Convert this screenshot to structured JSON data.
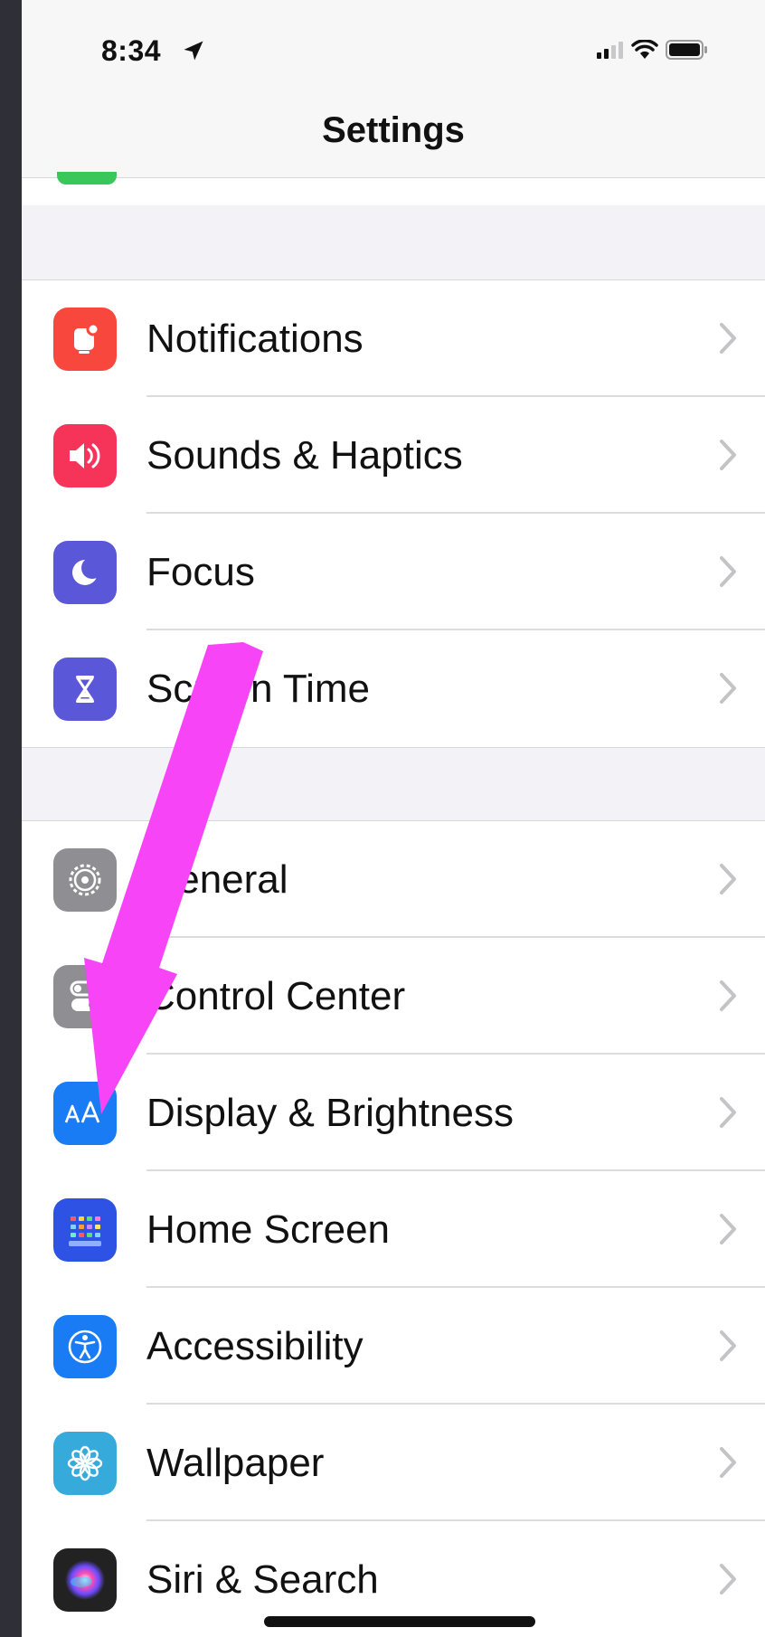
{
  "status_bar": {
    "time": "8:34",
    "icons": [
      "location-arrow-icon",
      "cellular-signal-icon",
      "wifi-icon",
      "battery-icon"
    ]
  },
  "navbar": {
    "title": "Settings"
  },
  "groups": [
    [
      {
        "label": "Notifications",
        "icon": "notifications-icon",
        "color": "#f8473d"
      },
      {
        "label": "Sounds & Haptics",
        "icon": "speaker-icon",
        "color": "#f6345a"
      },
      {
        "label": "Focus",
        "icon": "moon-icon",
        "color": "#5a57d9"
      },
      {
        "label": "Screen Time",
        "icon": "hourglass-icon",
        "color": "#5a57d9"
      }
    ],
    [
      {
        "label": "General",
        "icon": "gear-icon",
        "color": "#8e8e93"
      },
      {
        "label": "Control Center",
        "icon": "toggles-icon",
        "color": "#8e8e93"
      },
      {
        "label": "Display & Brightness",
        "icon": "text-size-icon",
        "color": "#1a7cf5"
      },
      {
        "label": "Home Screen",
        "icon": "home-grid-icon",
        "color": "#2d52e4"
      },
      {
        "label": "Accessibility",
        "icon": "accessibility-icon",
        "color": "#1a7cf5"
      },
      {
        "label": "Wallpaper",
        "icon": "flower-icon",
        "color": "#37aadc"
      },
      {
        "label": "Siri & Search",
        "icon": "siri-icon",
        "color": "#222222"
      }
    ]
  ],
  "annotation": {
    "arrow_color": "#f644f6",
    "points_to": "Display & Brightness"
  }
}
